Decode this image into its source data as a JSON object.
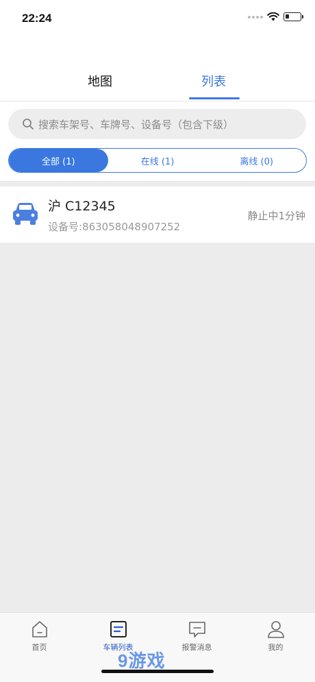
{
  "status_bar": {
    "time": "22:24"
  },
  "top_tabs": [
    {
      "label": "地图",
      "active": false
    },
    {
      "label": "列表",
      "active": true
    }
  ],
  "search": {
    "placeholder": "搜索车架号、车牌号、设备号（包含下级）"
  },
  "filters": [
    {
      "label": "全部 (1)",
      "active": true
    },
    {
      "label": "在线 (1)",
      "active": false
    },
    {
      "label": "离线 (0)",
      "active": false
    }
  ],
  "vehicles": [
    {
      "plate": "沪 C12345",
      "device": "设备号:863058048907252",
      "status": "静止中1分钟",
      "icon": "car-icon"
    }
  ],
  "bottom_nav": [
    {
      "label": "首页",
      "icon": "home-icon",
      "active": false
    },
    {
      "label": "车辆列表",
      "icon": "list-icon",
      "active": true
    },
    {
      "label": "报警消息",
      "icon": "message-icon",
      "active": false
    },
    {
      "label": "我的",
      "icon": "user-icon",
      "active": false
    }
  ],
  "watermark": "9游戏",
  "colors": {
    "accent": "#3a78e0",
    "background": "#ececec"
  }
}
